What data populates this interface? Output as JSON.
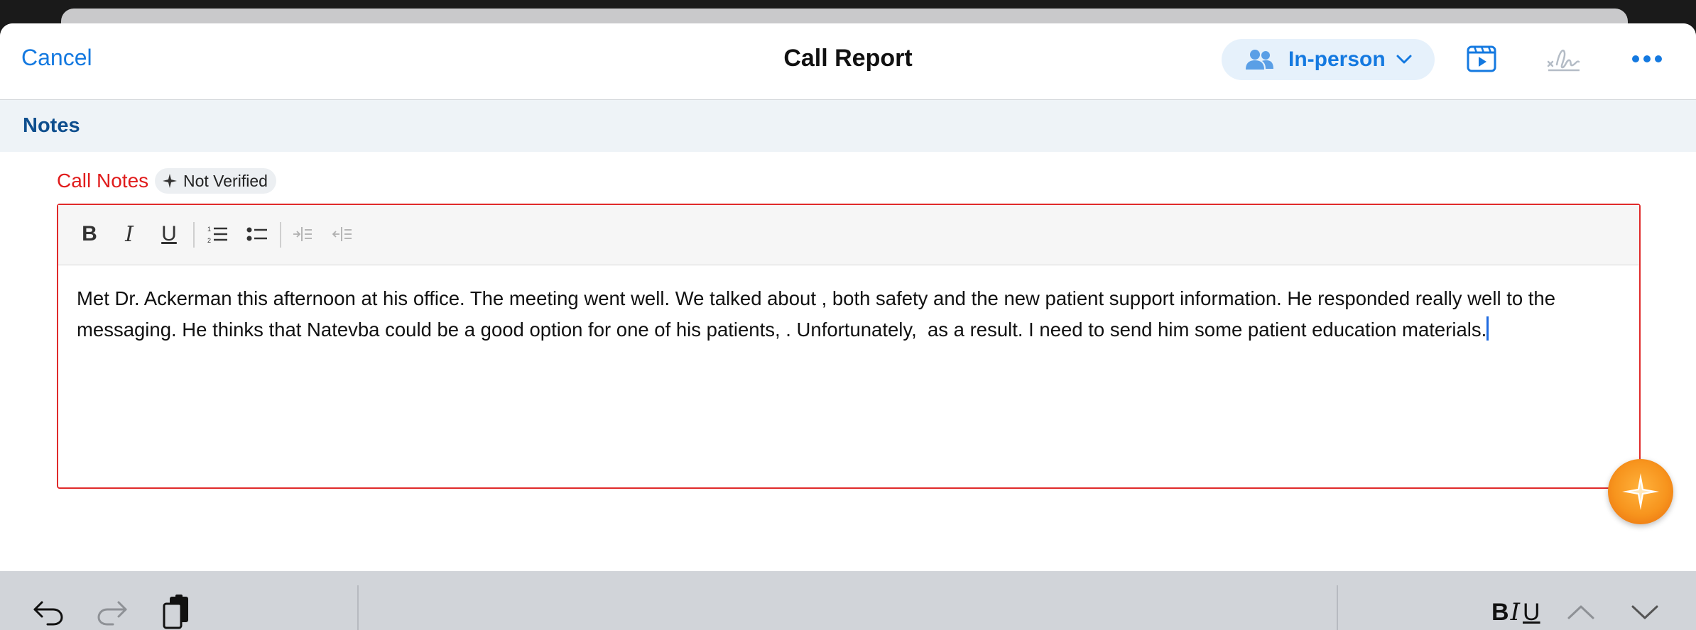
{
  "nav": {
    "cancel_label": "Cancel",
    "title": "Call Report",
    "call_type_label": "In-person",
    "icons": [
      "people-icon",
      "chevron-down-icon",
      "media-play-icon",
      "signature-icon",
      "more-icon"
    ]
  },
  "section": {
    "title": "Notes"
  },
  "field": {
    "label": "Call Notes",
    "badge_label": "Not Verified",
    "text": "Met Dr. Ackerman this afternoon at his office. The meeting went well. We talked about , both safety and the new patient support information. He responded really well to the messaging. He thinks that Natevba could be a good option for one of his patients, . Unfortunately,  as a result. I need to send him some patient education materials."
  },
  "editor_toolbar": {
    "bold": "B",
    "italic": "I",
    "underline": "U",
    "icons": [
      "bold-icon",
      "italic-icon",
      "underline-icon",
      "numbered-list-icon",
      "bulleted-list-icon",
      "indent-icon",
      "outdent-icon"
    ]
  },
  "keyboard_bar": {
    "format_b": "B",
    "format_i": "I",
    "format_u": "U",
    "icons": [
      "undo-icon",
      "redo-icon",
      "paste-icon",
      "chevron-up-icon",
      "chevron-down-icon"
    ]
  },
  "colors": {
    "accent": "#1479e0",
    "required_red": "#e01c1c",
    "section_title": "#0f4f8e",
    "fab_orange": "#f7941d"
  }
}
